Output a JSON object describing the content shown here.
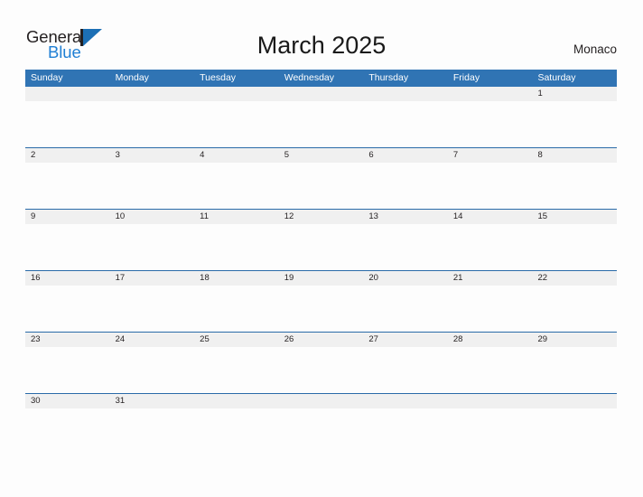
{
  "brand": {
    "name_part1": "General",
    "name_part2": "Blue",
    "logo_icon": "sail-triangle-icon",
    "color_dark": "#231f20",
    "color_blue": "#1f7fd4"
  },
  "header": {
    "title": "March 2025",
    "country": "Monaco"
  },
  "theme": {
    "header_blue": "#3074b4",
    "row_divider_blue": "#2a6ba8",
    "day_band_gray": "#f0f0f0",
    "page_background": "#fdfdfd"
  },
  "calendar": {
    "weekdays": [
      "Sunday",
      "Monday",
      "Tuesday",
      "Wednesday",
      "Thursday",
      "Friday",
      "Saturday"
    ],
    "weeks": [
      [
        "",
        "",
        "",
        "",
        "",
        "",
        "1"
      ],
      [
        "2",
        "3",
        "4",
        "5",
        "6",
        "7",
        "8"
      ],
      [
        "9",
        "10",
        "11",
        "12",
        "13",
        "14",
        "15"
      ],
      [
        "16",
        "17",
        "18",
        "19",
        "20",
        "21",
        "22"
      ],
      [
        "23",
        "24",
        "25",
        "26",
        "27",
        "28",
        "29"
      ],
      [
        "30",
        "31",
        "",
        "",
        "",
        "",
        ""
      ]
    ]
  }
}
